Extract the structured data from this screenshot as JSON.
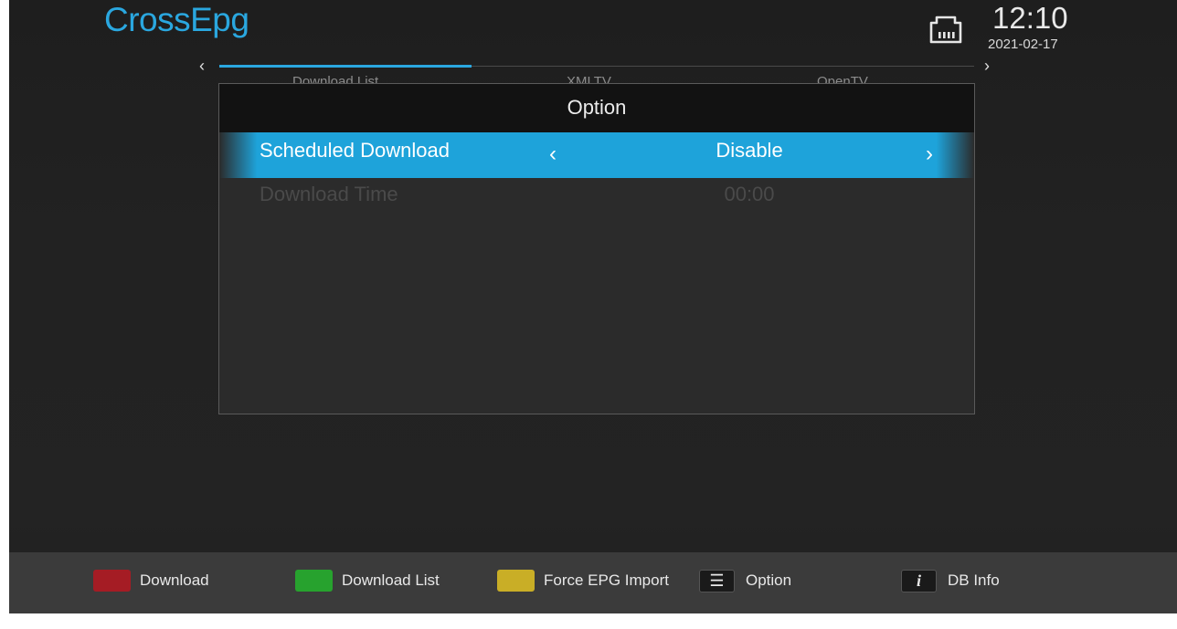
{
  "app": {
    "title": "CrossEpg"
  },
  "status": {
    "time": "12:10",
    "date": "2021-02-17",
    "network_icon": "ethernet-icon"
  },
  "tabs": {
    "prev_icon": "‹",
    "next_icon": "›",
    "items": [
      {
        "label": "Download List",
        "active": true
      },
      {
        "label": "XMLTV",
        "active": false
      },
      {
        "label": "OpenTV",
        "active": false
      }
    ]
  },
  "dialog": {
    "title": "Option",
    "rows": [
      {
        "label": "Scheduled Download",
        "value": "Disable",
        "selected": true,
        "prev": "‹",
        "next": "›"
      },
      {
        "label": "Download Time",
        "value": "00:00",
        "selected": false
      }
    ]
  },
  "bottom_bar": {
    "hints": [
      {
        "key": "red",
        "color": "#a51c24",
        "label": "Download"
      },
      {
        "key": "green",
        "color": "#27a22e",
        "label": "Download List"
      },
      {
        "key": "yellow",
        "color": "#c9ae26",
        "label": "Force EPG Import"
      },
      {
        "key": "menu",
        "icon": "list-icon",
        "glyph": "☰",
        "label": "Option"
      },
      {
        "key": "info",
        "icon": "info-icon",
        "glyph": "i",
        "label": "DB Info"
      }
    ]
  }
}
